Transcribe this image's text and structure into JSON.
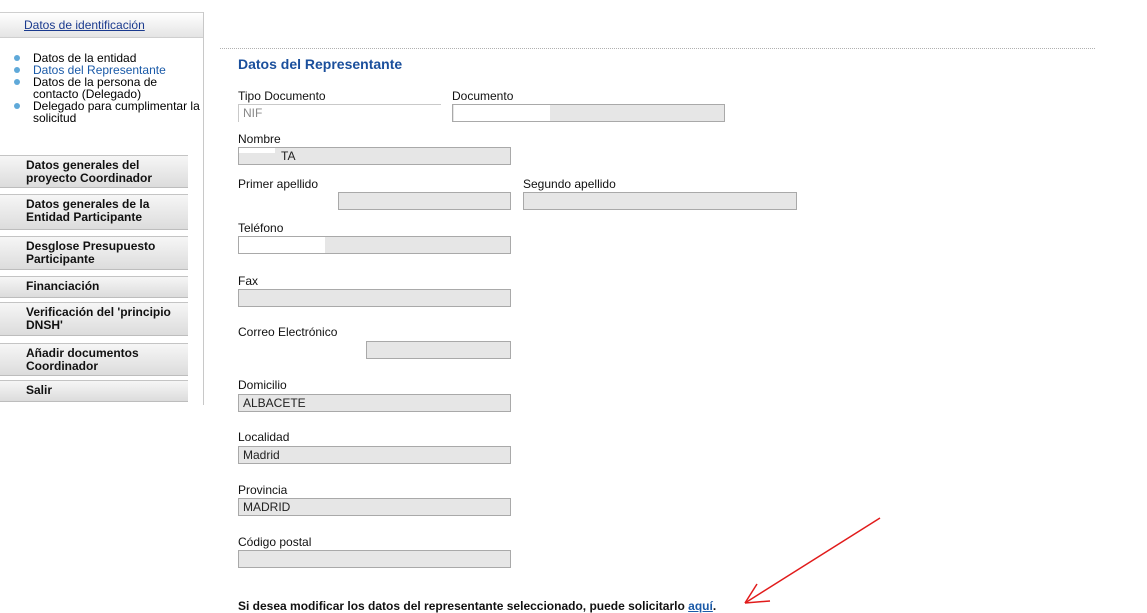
{
  "sidebar": {
    "section_title": "Datos de identificación",
    "sub_items": [
      {
        "label": "Datos de la entidad",
        "active": false
      },
      {
        "label": "Datos del Representante",
        "active": true
      },
      {
        "label": "Datos de la persona de contacto (Delegado)",
        "active": false
      },
      {
        "label": "Delegado para cumplimentar la solicitud",
        "active": false
      }
    ],
    "menu": [
      "Datos generales del proyecto Coordinador",
      "Datos generales de la Entidad Participante",
      "Desglose Presupuesto Participante",
      "Financiación",
      "Verificación del 'principio DNSH'",
      "Añadir documentos Coordinador",
      "Salir"
    ]
  },
  "main": {
    "title": "Datos del Representante",
    "fields": {
      "tipo_documento": {
        "label": "Tipo Documento",
        "value": "NIF"
      },
      "documento": {
        "label": "Documento",
        "value": ""
      },
      "nombre": {
        "label": "Nombre",
        "value": "TA"
      },
      "primer_apellido": {
        "label": "Primer apellido",
        "value": ""
      },
      "segundo_apellido": {
        "label": "Segundo apellido",
        "value": ""
      },
      "telefono": {
        "label": "Teléfono",
        "value": ""
      },
      "fax": {
        "label": "Fax",
        "value": ""
      },
      "correo": {
        "label": "Correo Electrónico",
        "value": ""
      },
      "domicilio": {
        "label": "Domicilio",
        "value": "ALBACETE"
      },
      "localidad": {
        "label": "Localidad",
        "value": "Madrid"
      },
      "provincia": {
        "label": "Provincia",
        "value": "MADRID"
      },
      "codigo_postal": {
        "label": "Código postal",
        "value": ""
      }
    },
    "footer_text": "Si desea modificar los datos del representante seleccionado, puede solicitarlo",
    "footer_link": "aquí",
    "footer_end": "."
  },
  "colors": {
    "title": "#1a4f9c",
    "link": "#1a5aa8",
    "arrow": "#e11b1b",
    "bullet": "#5fa9d9"
  }
}
